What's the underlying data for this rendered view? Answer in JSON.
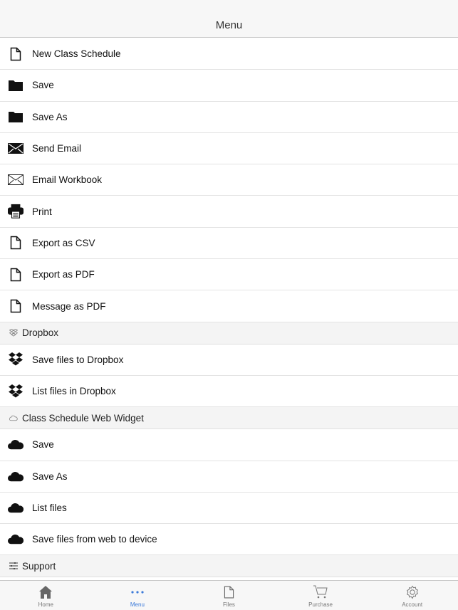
{
  "header": {
    "title": "Menu"
  },
  "items_main": [
    {
      "icon": "document-icon",
      "label": "New Class Schedule"
    },
    {
      "icon": "folder-icon",
      "label": "Save"
    },
    {
      "icon": "folder-icon",
      "label": "Save As"
    },
    {
      "icon": "envelope-filled-icon",
      "label": "Send Email"
    },
    {
      "icon": "envelope-outline-icon",
      "label": "Email Workbook"
    },
    {
      "icon": "printer-icon",
      "label": "Print"
    },
    {
      "icon": "document-icon",
      "label": "Export as CSV"
    },
    {
      "icon": "document-icon",
      "label": "Export as PDF"
    },
    {
      "icon": "document-icon",
      "label": "Message as PDF"
    }
  ],
  "sections": [
    {
      "title": "Dropbox",
      "icon": "dropbox-icon",
      "items": [
        {
          "icon": "dropbox-icon",
          "label": "Save files to Dropbox"
        },
        {
          "icon": "dropbox-icon",
          "label": "List files in Dropbox"
        }
      ]
    },
    {
      "title": "Class Schedule Web Widget",
      "icon": "cloud-outline-icon",
      "items": [
        {
          "icon": "cloud-icon",
          "label": "Save"
        },
        {
          "icon": "cloud-icon",
          "label": "Save As"
        },
        {
          "icon": "cloud-icon",
          "label": "List files"
        },
        {
          "icon": "cloud-icon",
          "label": "Save files from web to device"
        }
      ]
    },
    {
      "title": "Support",
      "icon": "sliders-icon",
      "items": []
    }
  ],
  "tabbar": {
    "active_color": "#3d7bd9",
    "tabs": [
      {
        "icon": "home-icon",
        "label": "Home",
        "active": false
      },
      {
        "icon": "more-dots-icon",
        "label": "Menu",
        "active": true
      },
      {
        "icon": "document-icon",
        "label": "Files",
        "active": false
      },
      {
        "icon": "cart-icon",
        "label": "Purchase",
        "active": false
      },
      {
        "icon": "gear-icon",
        "label": "Account",
        "active": false
      }
    ]
  }
}
